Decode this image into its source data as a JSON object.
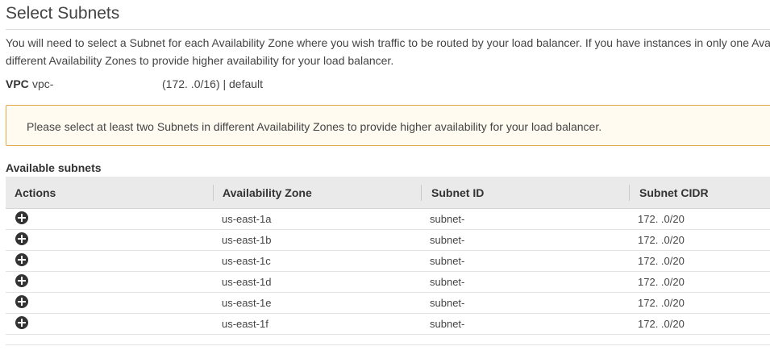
{
  "title": "Select Subnets",
  "intro": {
    "line1": "You will need to select a Subnet for each Availability Zone where you wish traffic to be routed by your load balancer. If you have instances in only one Ava",
    "line2": "different Availability Zones to provide higher availability for your load balancer."
  },
  "vpc": {
    "label": "VPC",
    "id": "vpc-",
    "cidr": "(172.        .0/16) | default"
  },
  "alert": {
    "message": "Please select at least two Subnets in different Availability Zones to provide higher availability for your load balancer.",
    "color": "#e3a84a"
  },
  "subnets": {
    "title": "Available subnets",
    "columns": {
      "actions": "Actions",
      "zone": "Availability Zone",
      "subnet_id": "Subnet ID",
      "cidr": "Subnet CIDR"
    },
    "action_icon": "plus-circle-icon",
    "rows": [
      {
        "zone": "us-east-1a",
        "subnet_id": "subnet-",
        "cidr": "172.        .0/20"
      },
      {
        "zone": "us-east-1b",
        "subnet_id": "subnet-",
        "cidr": "172.        .0/20"
      },
      {
        "zone": "us-east-1c",
        "subnet_id": "subnet-",
        "cidr": "172.        .0/20"
      },
      {
        "zone": "us-east-1d",
        "subnet_id": "subnet-",
        "cidr": "172.        .0/20"
      },
      {
        "zone": "us-east-1e",
        "subnet_id": "subnet-",
        "cidr": "172.        .0/20"
      },
      {
        "zone": "us-east-1f",
        "subnet_id": "subnet-",
        "cidr": "172.        .0/20"
      }
    ]
  }
}
